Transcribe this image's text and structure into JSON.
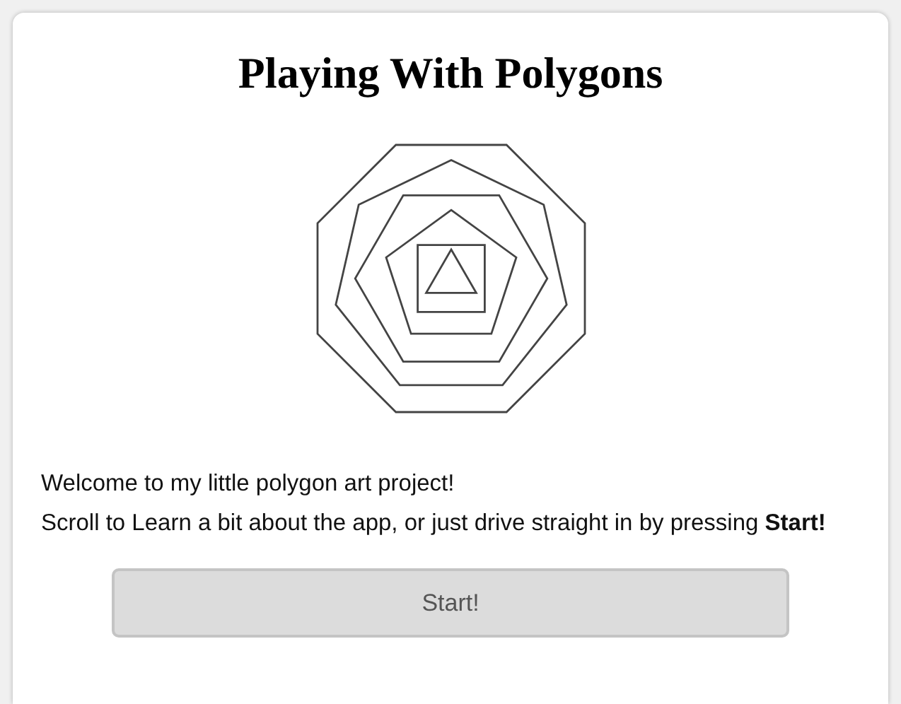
{
  "title": "Playing With Polygons",
  "paragraphs": [
    "Welcome to my little polygon art project!",
    "Scroll to Learn a bit about the app, or just drive straight in by pressing **Start!**"
  ],
  "button": {
    "label": "Start!",
    "disabled": true
  }
}
